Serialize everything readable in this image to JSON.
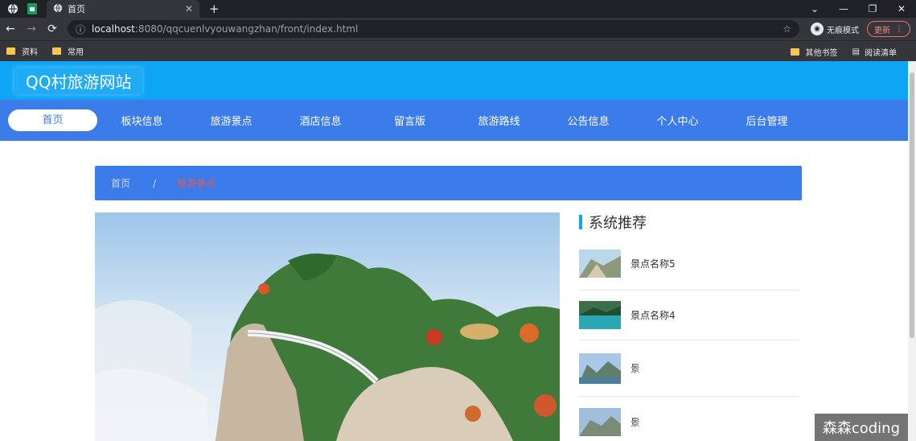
{
  "browser": {
    "tab_title": "首页",
    "url_host": "localhost",
    "url_path": ":8080/qqcuenlvyouwangzhan/front/index.html",
    "incognito_label": "无痕模式",
    "update_label": "更新",
    "bookmarks": [
      "资料",
      "常用"
    ],
    "bookmarks_right": [
      "其他书签",
      "阅读清单"
    ]
  },
  "site": {
    "logo": "QQ村旅游网站",
    "nav": [
      "首页",
      "板块信息",
      "旅游景点",
      "酒店信息",
      "留言版",
      "旅游路线",
      "公告信息",
      "个人中心",
      "后台管理"
    ],
    "breadcrumb_home": "首页",
    "breadcrumb_sep": "/",
    "breadcrumb_current": "旅游景点"
  },
  "sidebar": {
    "title": "系统推荐",
    "items": [
      {
        "name": "景点名称5"
      },
      {
        "name": "景点名称4"
      },
      {
        "name": "景"
      },
      {
        "name": "景"
      }
    ]
  },
  "watermark": "森森coding",
  "colors": {
    "header": "#0ea5f5",
    "nav": "#3b7bea",
    "accent": "#0ea5f5"
  }
}
